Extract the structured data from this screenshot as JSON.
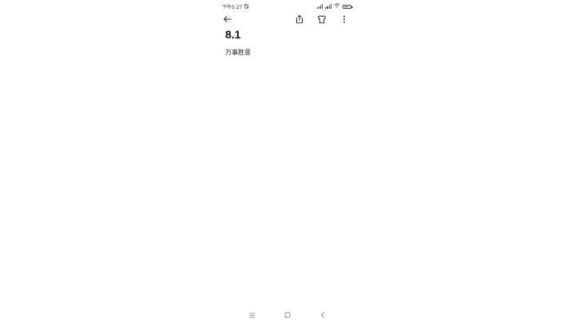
{
  "status_bar": {
    "time": "下午5:27",
    "icons": [
      "alarm-off-icon",
      "signal-icon",
      "signal-icon",
      "wifi-icon",
      "battery-icon"
    ]
  },
  "app_bar": {
    "icons": [
      "back-arrow-icon",
      "share-icon",
      "shirt-theme-icon",
      "more-vertical-icon"
    ]
  },
  "note": {
    "title": "8.1",
    "body": "万事胜意"
  },
  "nav_bar": {
    "icons": [
      "menu-icon",
      "home-square-icon",
      "back-chevron-icon"
    ]
  },
  "colors": {
    "background": "#ffffff",
    "text": "#111111",
    "icon": "#333333"
  }
}
